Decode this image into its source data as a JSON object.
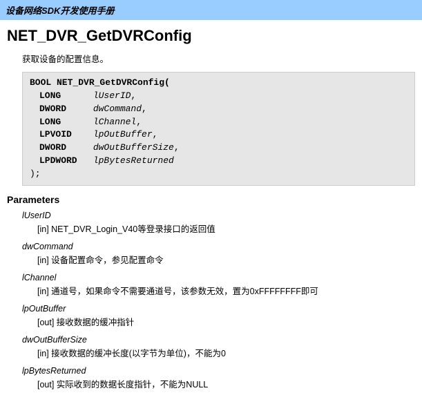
{
  "header": {
    "breadcrumb": "设备网络SDK开发使用手册"
  },
  "title": "NET_DVR_GetDVRConfig",
  "summary": "获取设备的配置信息。",
  "signature": {
    "open": "BOOL NET_DVR_GetDVRConfig(",
    "close": ");",
    "params": [
      {
        "type": "LONG",
        "name": "lUserID"
      },
      {
        "type": "DWORD",
        "name": "dwCommand"
      },
      {
        "type": "LONG",
        "name": "lChannel"
      },
      {
        "type": "LPVOID",
        "name": "lpOutBuffer"
      },
      {
        "type": "DWORD",
        "name": "dwOutBufferSize"
      },
      {
        "type": "LPDWORD",
        "name": "lpBytesReturned"
      }
    ]
  },
  "sections": {
    "parameters_heading": "Parameters"
  },
  "parameters": [
    {
      "name": "lUserID",
      "desc": "[in] NET_DVR_Login_V40等登录接口的返回值"
    },
    {
      "name": "dwCommand",
      "desc": "[in] 设备配置命令，参见配置命令"
    },
    {
      "name": "lChannel",
      "desc": "[in] 通道号，如果命令不需要通道号，该参数无效，置为0xFFFFFFFF即可"
    },
    {
      "name": "lpOutBuffer",
      "desc": "[out] 接收数据的缓冲指针"
    },
    {
      "name": "dwOutBufferSize",
      "desc": "[in] 接收数据的缓冲长度(以字节为单位)，不能为0"
    },
    {
      "name": "lpBytesReturned",
      "desc": "[out] 实际收到的数据长度指针，不能为NULL"
    }
  ]
}
